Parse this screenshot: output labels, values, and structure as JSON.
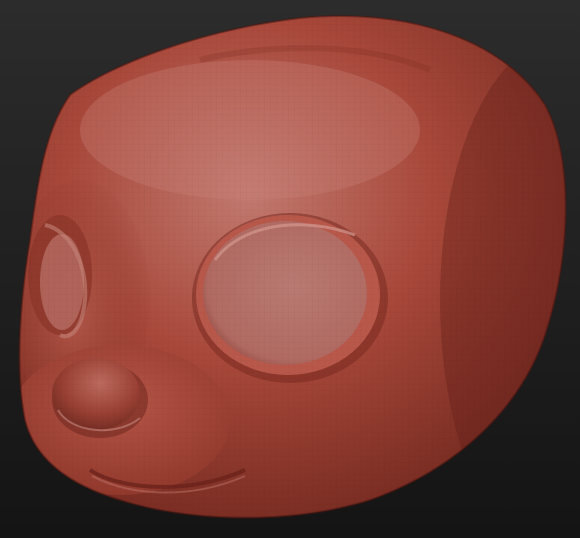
{
  "viewport": {
    "background_top": "#2c2c2c",
    "background_bottom": "#141414"
  },
  "model": {
    "subject": "sculpted-character-head",
    "material": "clay",
    "base_color": "#a8483a",
    "highlight_color": "#c27a70",
    "shadow_color": "#6e261d",
    "eye_socket_color": "#b06a62",
    "wireframe_visible": true
  }
}
